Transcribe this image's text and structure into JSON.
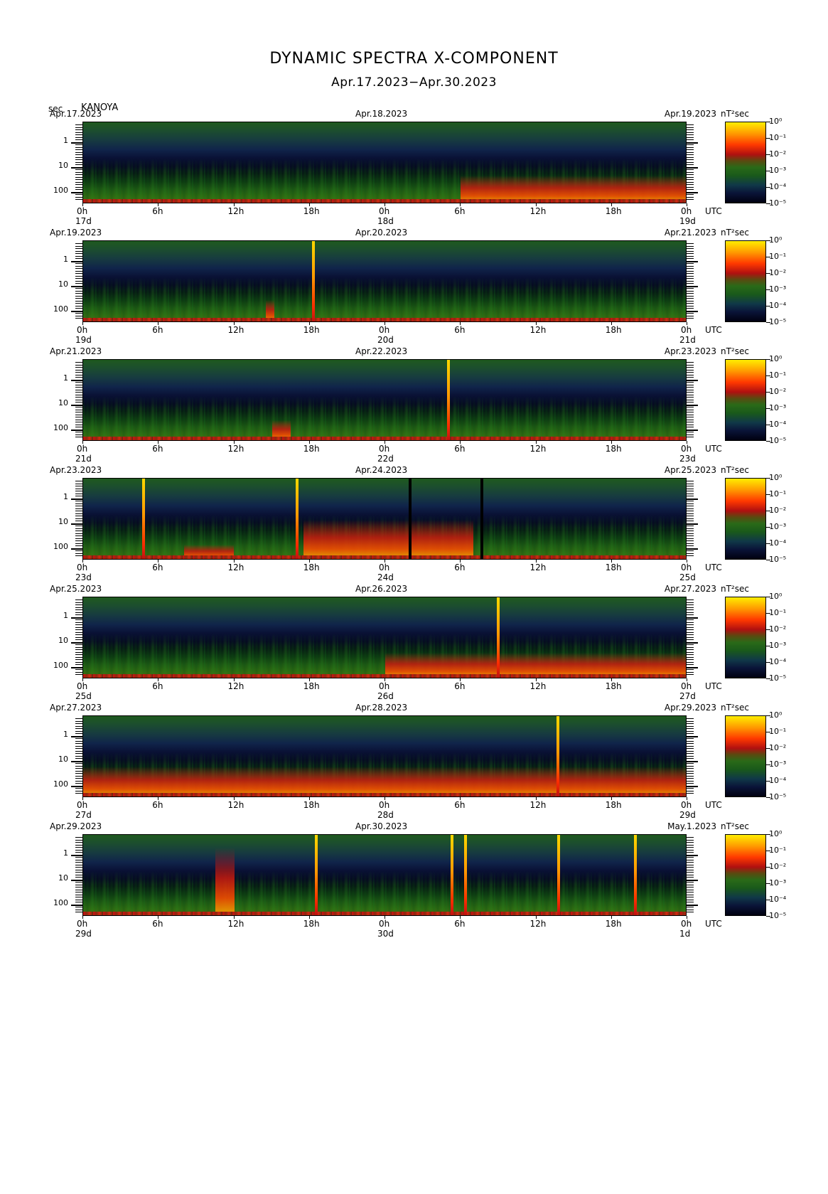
{
  "title": "DYNAMIC SPECTRA X-COMPONENT",
  "subtitle": "Apr.17.2023−Apr.30.2023",
  "station": "KANOYA",
  "y_unit": "sec",
  "x_unit": "UTC",
  "chart_data": {
    "type": "heatmap",
    "y_axis": {
      "label": "sec",
      "scale": "log",
      "ticks": [
        "1",
        "10",
        "100"
      ]
    },
    "x_ticks": [
      "0h",
      "6h",
      "12h",
      "18h",
      "0h",
      "6h",
      "12h",
      "18h",
      "0h"
    ],
    "colorbar": {
      "unit": "nT²sec",
      "ticks": [
        "10⁰",
        "10⁻¹",
        "10⁻²",
        "10⁻³",
        "10⁻⁴",
        "10⁻⁵"
      ]
    },
    "panels": [
      {
        "start_date": "Apr.17.2023",
        "mid_date": "Apr.18.2023",
        "end_date": "Apr.19.2023",
        "day_labels": [
          "17d",
          "18d",
          "19d"
        ]
      },
      {
        "start_date": "Apr.19.2023",
        "mid_date": "Apr.20.2023",
        "end_date": "Apr.21.2023",
        "day_labels": [
          "19d",
          "20d",
          "21d"
        ]
      },
      {
        "start_date": "Apr.21.2023",
        "mid_date": "Apr.22.2023",
        "end_date": "Apr.23.2023",
        "day_labels": [
          "21d",
          "22d",
          "23d"
        ]
      },
      {
        "start_date": "Apr.23.2023",
        "mid_date": "Apr.24.2023",
        "end_date": "Apr.25.2023",
        "day_labels": [
          "23d",
          "24d",
          "25d"
        ]
      },
      {
        "start_date": "Apr.25.2023",
        "mid_date": "Apr.26.2023",
        "end_date": "Apr.27.2023",
        "day_labels": [
          "25d",
          "26d",
          "27d"
        ]
      },
      {
        "start_date": "Apr.27.2023",
        "mid_date": "Apr.28.2023",
        "end_date": "Apr.29.2023",
        "day_labels": [
          "27d",
          "28d",
          "29d"
        ]
      },
      {
        "start_date": "Apr.29.2023",
        "mid_date": "Apr.30.2023",
        "end_date": "May.1.2023",
        "day_labels": [
          "29d",
          "30d",
          "1d"
        ]
      }
    ]
  }
}
